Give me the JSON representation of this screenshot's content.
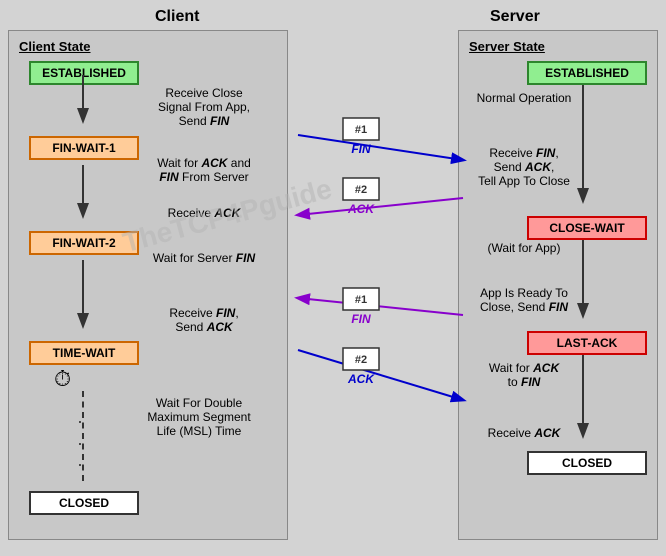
{
  "headers": {
    "client": "Client",
    "server": "Server"
  },
  "client": {
    "section_title": "Client State",
    "states": {
      "established": "ESTABLISHED",
      "fin_wait_1": "FIN-WAIT-1",
      "fin_wait_2": "FIN-WAIT-2",
      "time_wait": "TIME-WAIT",
      "closed": "CLOSED"
    },
    "labels": {
      "step1": "Receive Close",
      "step1b": "Signal From App,",
      "step1c": "Send FIN",
      "step2": "Wait for ACK and",
      "step2b": "FIN From Server",
      "step3": "Receive ACK",
      "step4": "Wait for Server FIN",
      "step5": "Receive FIN,",
      "step5b": "Send ACK",
      "step6": "Wait For Double",
      "step6b": "Maximum Segment",
      "step6c": "Life (MSL) Time"
    }
  },
  "server": {
    "section_title": "Server State",
    "states": {
      "established": "ESTABLISHED",
      "close_wait": "CLOSE-WAIT",
      "last_ack": "LAST-ACK",
      "closed": "CLOSED"
    },
    "labels": {
      "step1": "Normal Operation",
      "step2": "Receive FIN,",
      "step2b": "Send ACK,",
      "step2c": "Tell App To Close",
      "step3": "(Wait for App)",
      "step4": "App Is Ready To",
      "step4b": "Close, Send FIN",
      "step5": "Wait for ACK",
      "step5b": "to FIN",
      "step6": "Receive ACK"
    }
  },
  "messages": {
    "fin1_label": "#1",
    "fin1_text": "FIN",
    "ack2_label": "#2",
    "ack2_text": "ACK",
    "fin3_label": "#1",
    "fin3_text": "FIN",
    "ack4_label": "#2",
    "ack4_text": "ACK"
  },
  "watermark": "TheTCP4Pguide"
}
